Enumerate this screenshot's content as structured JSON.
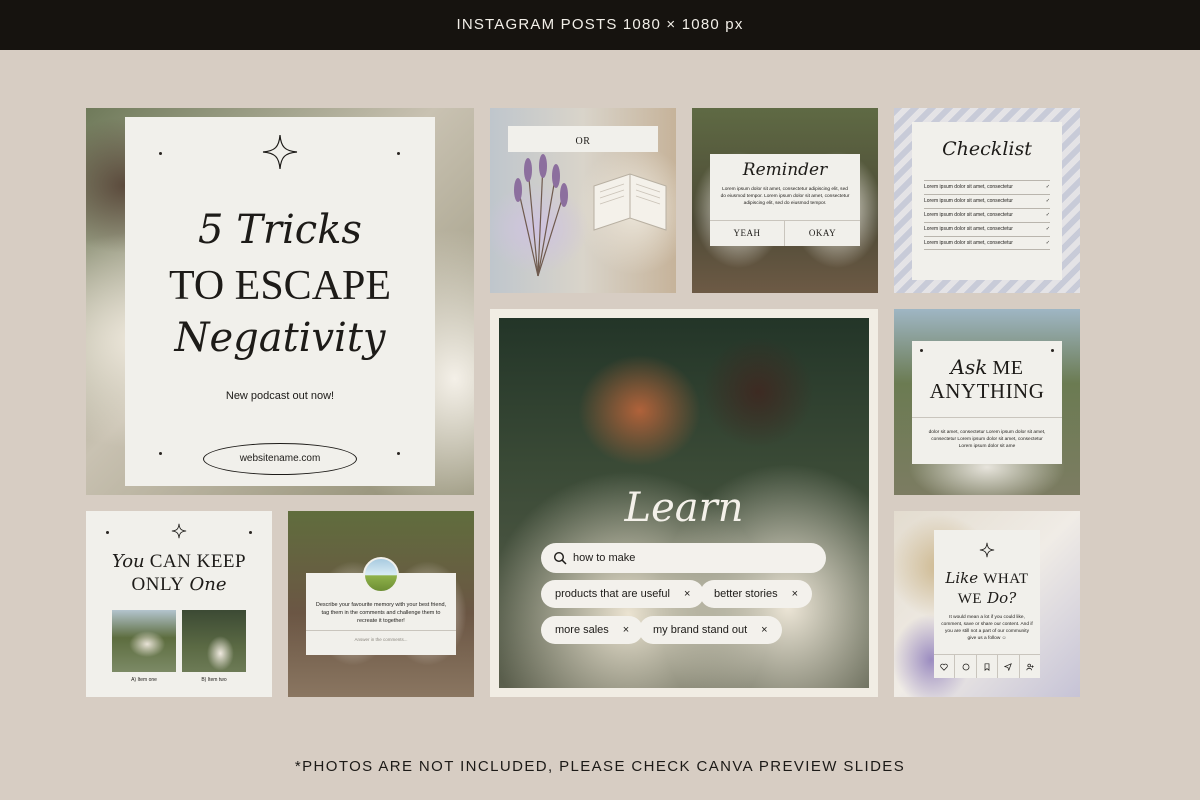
{
  "header": {
    "title": "INSTAGRAM POSTS 1080 × 1080 px"
  },
  "footer": {
    "note": "*PHOTOS ARE NOT INCLUDED, PLEASE CHECK CANVA PREVIEW SLIDES"
  },
  "post_tricks": {
    "line1": "5 Tricks",
    "line2": "TO ESCAPE",
    "line3": "Negativity",
    "subtitle": "New podcast out now!",
    "website": "websitename.com"
  },
  "post_or": {
    "label": "OR"
  },
  "post_reminder": {
    "title": "Reminder",
    "body": "Lorem ipsum dolor sit amet, consectetur adipiscing elit, sed do eiusmod tempor. Lorem ipsum dolor sit amet, consectetur adipiscing elit, sed do eiusmod tempor.",
    "yes": "YEAH",
    "okay": "OKAY"
  },
  "post_checklist": {
    "title": "Checklist",
    "items": [
      "Lorem ipsum dolor sit amet, consectetur",
      "Lorem ipsum dolor sit amet, consectetur",
      "Lorem ipsum dolor sit amet, consectetur",
      "Lorem ipsum dolor sit amet, consectetur",
      "Lorem ipsum dolor sit amet, consectetur"
    ],
    "check": "✓"
  },
  "post_ask": {
    "ask": "Ask",
    "me": "ME",
    "anything": "ANYTHING",
    "body": "dolor sit amet, consectetur Lorem ipsum dolor sit amet, consectetur Lorem ipsum dolor sit amet, consectetur Lorem ipsum dolor sit ame"
  },
  "post_learn": {
    "title": "Learn",
    "search": "how to make",
    "chips": [
      {
        "label": "products that are useful"
      },
      {
        "label": "better stories"
      },
      {
        "label": "more sales"
      },
      {
        "label": "my brand stand out"
      }
    ],
    "close": "×"
  },
  "post_keep": {
    "you": "You",
    "can_keep": "CAN KEEP",
    "only": "ONLY",
    "one": "One",
    "option_a": "A) Item one",
    "option_b": "B) Item two"
  },
  "post_memory": {
    "body": "Describe your favourite memory with your best friend, tag them in the comments and challenge them to recreate it together!",
    "answer": "Answer in the comments..."
  },
  "post_like": {
    "like": "Like",
    "what": "WHAT",
    "we": "WE",
    "do": "Do?",
    "body": "It would mean a lot if you could like, comment, save or share our content. And if you are still not a part of our community give us a follow ☺"
  }
}
